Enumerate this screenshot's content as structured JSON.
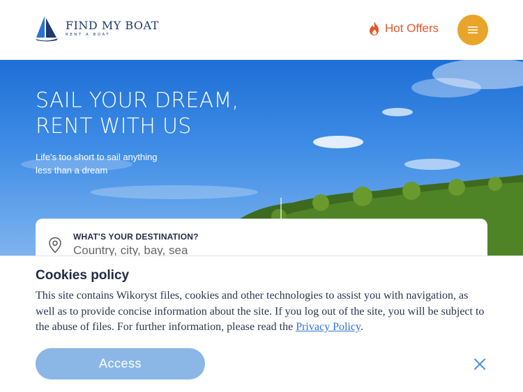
{
  "header": {
    "logo_title": "FIND MY BOAT",
    "logo_subtitle": "RENT A BOAT",
    "logo_icon": "sailboat-icon",
    "hot_offers_label": "Hot Offers",
    "hot_offers_icon": "flame-icon",
    "menu_icon": "hamburger-icon"
  },
  "hero": {
    "title_line1": "SAIL YOUR DREAM,",
    "title_line2": "RENT WITH US",
    "subtitle_line1": "Life's too short to sail anything",
    "subtitle_line2": "less than a dream"
  },
  "search": {
    "label": "WHAT'S YOUR DESTINATION?",
    "placeholder": "Country, city, bay, sea",
    "icon": "map-pin-icon"
  },
  "cookies": {
    "title": "Cookies policy",
    "text": "This site contains Wikoryst files, cookies and other technologies to assist you with navigation, as well as to provide concise information about the site. If you log out of the site, you will be subject to the abuse of files. For further information, please read the ",
    "link_text": "Privacy Policy",
    "text_end": ".",
    "access_label": "Access",
    "close_icon": "close-icon"
  },
  "colors": {
    "brand_navy": "#1e3a6e",
    "accent_orange": "#e9a52a",
    "hot_red": "#e4572a",
    "access_blue": "#8ab7e6",
    "link_blue": "#2d73d6"
  }
}
